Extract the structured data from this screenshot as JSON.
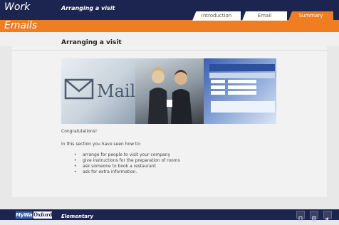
{
  "header": {
    "app_title_line1": "Work",
    "app_title_line2": "Emails",
    "unit_title": "Arranging a visit",
    "tabs": [
      {
        "label": "Introduction",
        "active": false
      },
      {
        "label": "Email",
        "active": false
      },
      {
        "label": "Summary",
        "active": true
      }
    ]
  },
  "main": {
    "page_title": "Arranging a visit",
    "hero_image_text": "Mail",
    "intro": "Congratulations!",
    "lead": "In this section you have seen how to:",
    "bullets": [
      "arrange for people to visit your company",
      "give instructions for the preparation of rooms",
      "ask someone to book a restaurant",
      "ask for extra information."
    ]
  },
  "footer": {
    "logo_left": "MyWay",
    "logo_right": "Oxford",
    "level": "Elementary",
    "icons": [
      "document-icon",
      "grid-icon",
      "speaker-icon"
    ]
  },
  "colors": {
    "navy": "#1c2450",
    "orange": "#ef7d22",
    "content_bg": "#f2f2f2"
  }
}
